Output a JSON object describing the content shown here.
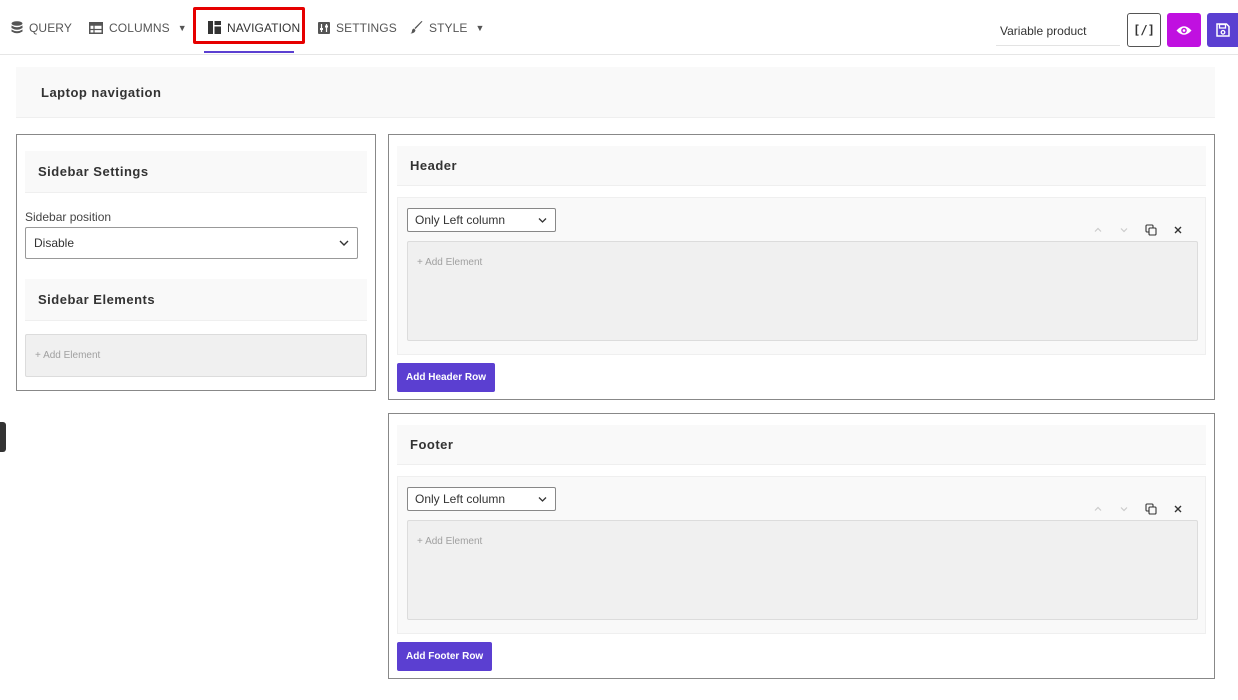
{
  "toolbar": {
    "tabs": [
      {
        "label": "QUERY",
        "icon": "database-icon"
      },
      {
        "label": "COLUMNS",
        "icon": "table-icon",
        "has_dropdown": true
      },
      {
        "label": "NAVIGATION",
        "icon": "layout-icon",
        "active": true
      },
      {
        "label": "SETTINGS",
        "icon": "sliders-icon"
      },
      {
        "label": "STYLE",
        "icon": "brush-icon",
        "has_dropdown": true
      }
    ],
    "product_field_value": "Variable product",
    "shortcode_label": "[/]",
    "preview_icon": "eye-icon",
    "save_icon": "save-icon"
  },
  "section": {
    "title": "Laptop navigation"
  },
  "sidebar": {
    "settings_title": "Sidebar Settings",
    "position_label": "Sidebar position",
    "position_value": "Disable",
    "elements_title": "Sidebar Elements",
    "add_element": "+ Add Element"
  },
  "header": {
    "title": "Header",
    "column_select": "Only Left column",
    "add_element": "+ Add Element",
    "add_row_button": "Add Header Row"
  },
  "footer": {
    "title": "Footer",
    "column_select": "Only Left column",
    "add_element": "+ Add Element",
    "add_row_button": "Add Footer Row"
  },
  "colors": {
    "accent": "#5b3fd1",
    "preview": "#c010e0",
    "highlight": "#e60000"
  }
}
